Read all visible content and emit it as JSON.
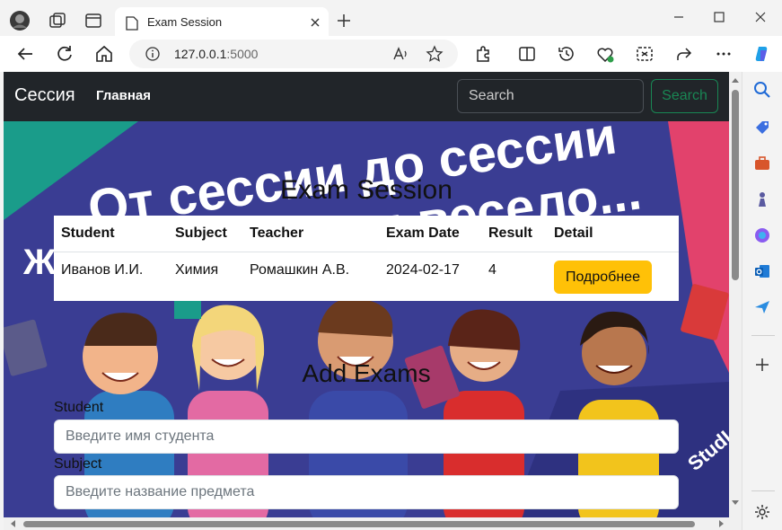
{
  "browser": {
    "tab_title": "Exam Session",
    "url_host": "127.0.0.1",
    "url_port": ":5000"
  },
  "navbar": {
    "brand": "Сессия",
    "link_home": "Главная",
    "search_placeholder": "Search",
    "search_button": "Search"
  },
  "banner": {
    "line1": "От сессии до сессии",
    "line2": "студенты весело...",
    "side_letter": "Ж",
    "logo_text": "StudLearn"
  },
  "main": {
    "title": "Exam Session",
    "table": {
      "headers": [
        "Student",
        "Subject",
        "Teacher",
        "Exam Date",
        "Result",
        "Detail"
      ],
      "rows": [
        {
          "student": "Иванов И.И.",
          "subject": "Химия",
          "teacher": "Ромашкин А.В.",
          "date": "2024-02-17",
          "result": "4",
          "detail": "Подробнее"
        }
      ]
    },
    "add_title": "Add Exams",
    "form": {
      "student_label": "Student",
      "student_placeholder": "Введите имя студента",
      "subject_label": "Subject",
      "subject_placeholder": "Введите название предмета"
    }
  },
  "colors": {
    "navbar_bg": "#212529",
    "hero_bg": "#3a3d93",
    "search_green": "#198754",
    "detail_yellow": "#ffc107"
  }
}
